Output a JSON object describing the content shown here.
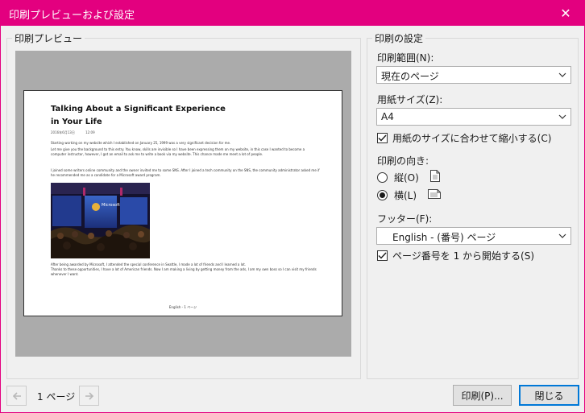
{
  "window": {
    "title": "印刷プレビューおよび設定",
    "close_glyph": "✕"
  },
  "preview": {
    "group_label": "印刷プレビュー",
    "document": {
      "title": "Talking About a Significant Experience in Your Life",
      "date": "2016年6月13日",
      "time": "12:09",
      "paragraphs": [
        "Starting working on my website which I established on January 25, 1999 was a very significant decision for me.",
        "Let me give you the background to this entry. You know, skills are invisible so I have been expressing them on my website, in this case I wanted to become a computer instructor, however, I got an email to ask me to write a book via my website. This chance made me meet a lot of people.",
        "I joined some writers online community and the owner invited me to some SNS. After I joined a tech community on the SNS, the community administrator asked me if he recommended me as a candidate for a Microsoft award program."
      ],
      "photo_sign_text": "Microsoft Most Valuable Professional",
      "after_photo": [
        "After being awarded by Microsoft, I attended the special conference in Seattle, I made a lot of friends and I learned a lot.",
        "Thanks to these opportunities, I have a lot of American friends. Now I am making a living by getting money from the ads, I am my own boss so I can visit my friends whenever I want."
      ],
      "footer": "English - 1 ページ"
    }
  },
  "settings": {
    "group_label": "印刷の設定",
    "print_range": {
      "label": "印刷範囲(N):",
      "value": "現在のページ"
    },
    "paper_size": {
      "label": "用紙サイズ(Z):",
      "value": "A4"
    },
    "shrink_to_fit": {
      "label": "用紙のサイズに合わせて縮小する(C)",
      "checked": true
    },
    "orientation": {
      "label": "印刷の向き:",
      "portrait_label": "縦(O)",
      "landscape_label": "横(L)",
      "selected": "landscape"
    },
    "footer": {
      "label": "フッター(F):",
      "value": "English - (番号) ページ"
    },
    "start_page_one": {
      "label": "ページ番号を 1 から開始する(S)",
      "checked": true
    }
  },
  "bottom": {
    "page_indicator": "1 ページ",
    "print_button": "印刷(P)...",
    "close_button": "閉じる"
  },
  "colors": {
    "accent": "#e3007f",
    "primary_border": "#0078d7"
  }
}
